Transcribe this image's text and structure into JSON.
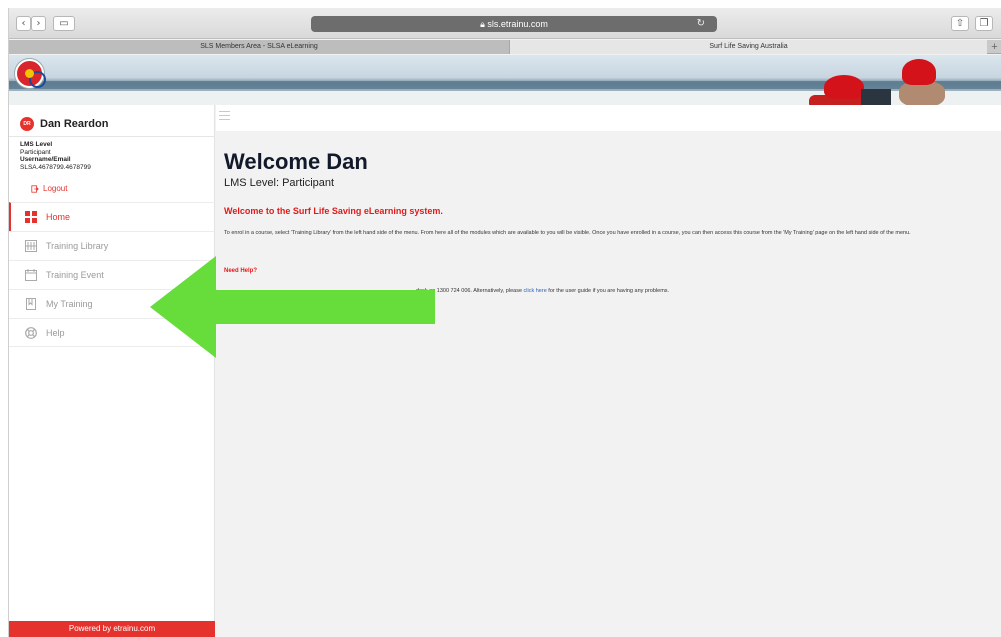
{
  "browser": {
    "address": "sls.etrainu.com",
    "tabs": [
      {
        "label": "SLS Members Area - SLSA eLearning"
      },
      {
        "label": "Surf Life Saving Australia"
      }
    ]
  },
  "user": {
    "initials": "DR",
    "name": "Dan Reardon",
    "lms_level_label": "LMS Level",
    "lms_level_value": "Participant",
    "username_label": "Username/Email",
    "username_value": "SLSA.4678799.4678799",
    "logout_label": "Logout"
  },
  "menu": {
    "items": [
      {
        "label": "Home",
        "icon": "home-grid-icon"
      },
      {
        "label": "Training Library",
        "icon": "library-icon"
      },
      {
        "label": "Training Event",
        "icon": "calendar-icon"
      },
      {
        "label": "My Training",
        "icon": "bookmark-icon"
      },
      {
        "label": "Help",
        "icon": "lifebuoy-icon"
      }
    ],
    "active_index": 0
  },
  "footer": {
    "powered_label": "Powered by etrainu.com"
  },
  "main": {
    "welcome": "Welcome Dan",
    "level_line": "LMS Level: Participant",
    "intro_heading": "Welcome to the Surf Life Saving eLearning system.",
    "intro_text": "To enrol in a course, select 'Training Library' from the left hand side of the menu. From here all of the modules which are available to you will be visible. Once you have enrolled in a course, you can then access this course from the 'My Training' page on the left hand side of the menu.",
    "help_heading": "Need Help?",
    "help_text_before": "desk on 1300 724 006. Alternatively, please ",
    "help_link": "click here",
    "help_text_after": " for the user guide if you are having any problems."
  },
  "colors": {
    "accent": "#e5322d",
    "annotation_arrow": "#66dd3a"
  }
}
